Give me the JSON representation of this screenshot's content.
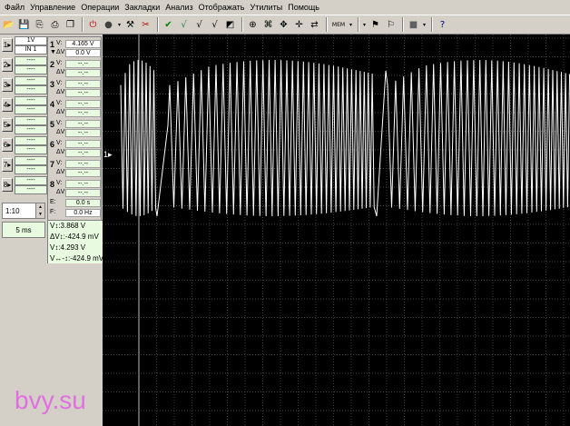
{
  "menu": [
    "Файл",
    "Управление",
    "Операции",
    "Закладки",
    "Анализ",
    "Отображать",
    "Утилиты",
    "Помощь"
  ],
  "toolbar": {
    "icons": [
      "open-folder-icon",
      "save-icon",
      "export-icon",
      "print-icon",
      "copy-icon",
      "stop-icon",
      "record-icon",
      "record-dropdown-icon",
      "tools-icon",
      "cut-icon",
      "check-icon",
      "check-v1-icon",
      "check-v2-icon",
      "check-v3-icon",
      "graph-icon",
      "zoom-icon",
      "device-icon",
      "move-icon",
      "cursor-icon",
      "arrows-icon",
      "memory-icon",
      "memory-dropdown-icon",
      "folder-dropdown-icon",
      "marker-icon",
      "flag-icon",
      "fill-icon",
      "fill-dropdown-icon",
      "help-icon"
    ],
    "memory_label": "MEM"
  },
  "channels": [
    {
      "btn": "1",
      "scale": "1V",
      "input": "IN 1"
    },
    {
      "btn": "2",
      "scale": "----",
      "input": "----"
    },
    {
      "btn": "3",
      "scale": "----",
      "input": "----"
    },
    {
      "btn": "4",
      "scale": "----",
      "input": "----"
    },
    {
      "btn": "5",
      "scale": "----",
      "input": "----"
    },
    {
      "btn": "6",
      "scale": "----",
      "input": "----"
    },
    {
      "btn": "7",
      "scale": "----",
      "input": "----"
    },
    {
      "btn": "8",
      "scale": "----",
      "input": "----"
    }
  ],
  "timebase": {
    "ratio": "1:10",
    "time_div": "5 ms"
  },
  "measurements": [
    {
      "num": "1",
      "v": "4.165 V",
      "dv": "0.0 V"
    },
    {
      "num": "2",
      "v": "--.--",
      "dv": "--.--"
    },
    {
      "num": "3",
      "v": "--.--",
      "dv": "--.--"
    },
    {
      "num": "4",
      "v": "--.--",
      "dv": "--.--"
    },
    {
      "num": "5",
      "v": "--.--",
      "dv": "--.--"
    },
    {
      "num": "6",
      "v": "--.--",
      "dv": "--.--"
    },
    {
      "num": "7",
      "v": "--.--",
      "dv": "--.--"
    },
    {
      "num": "8",
      "v": "--.--",
      "dv": "--.--"
    }
  ],
  "meas_labels": {
    "v": "V:",
    "dv": "ΔV:",
    "e": "E:",
    "f": "F:"
  },
  "freq": {
    "e_val": "0.0 s",
    "f_val": "0.0 Hz"
  },
  "cursors": [
    "V↕:3.868 V",
    "ΔV↕:-424.9 mV",
    "V↕:4.293 V",
    "V↔-↕:-424.9 mV"
  ],
  "scope": {
    "marker": "1▸",
    "background": "#000000",
    "trace_color": "#ffffff",
    "grid_color": "#5a5a5a"
  },
  "watermark": "bvy.su",
  "colors": {
    "window": "#d4d0c8",
    "value_bg": "#e8fbe0",
    "watermark": "#e070e0"
  }
}
